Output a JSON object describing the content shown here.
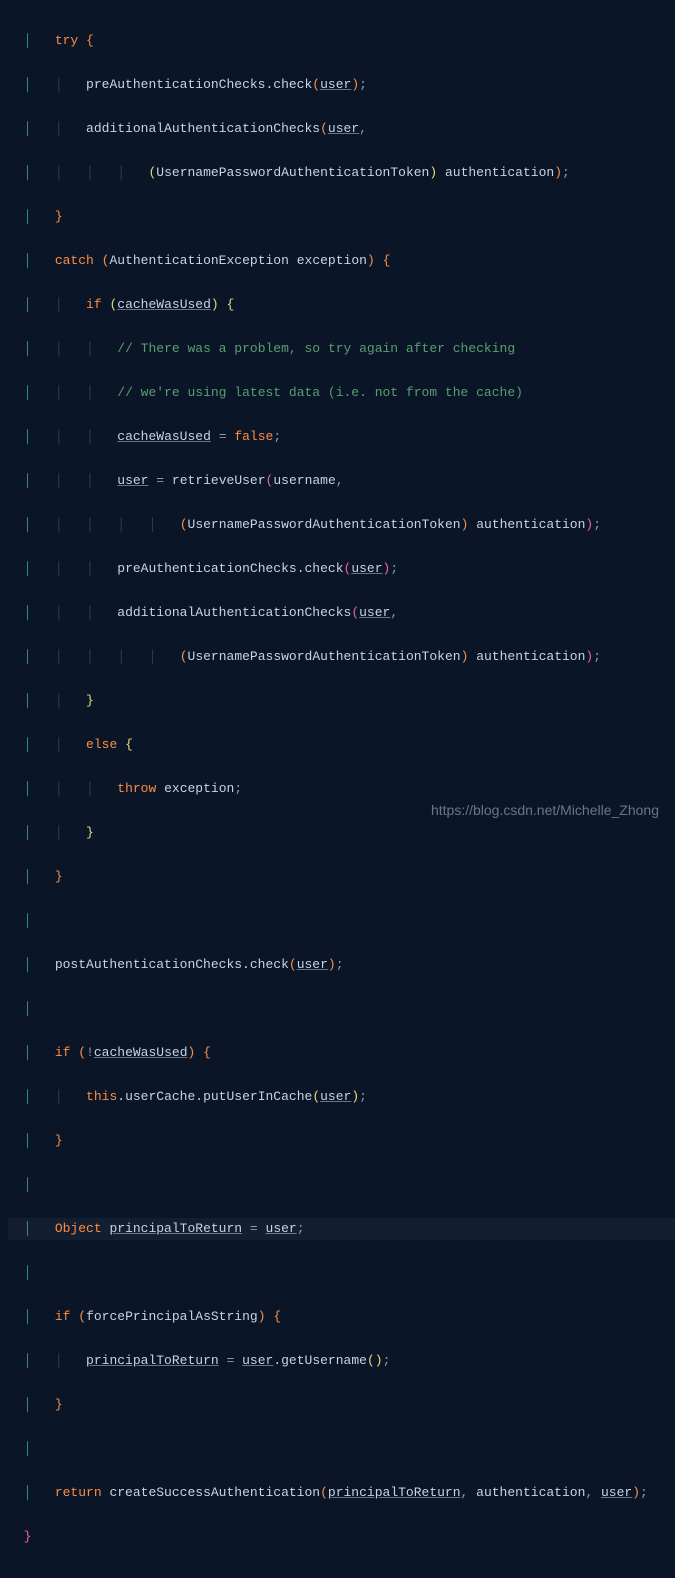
{
  "code": {
    "l1a": "try",
    "l2a": "preAuthenticationChecks.check",
    "l2b": "user",
    "l3a": "additionalAuthenticationChecks",
    "l3b": "user",
    "l4a": "UsernamePasswordAuthenticationToken",
    "l4b": "authentication",
    "l6a": "catch",
    "l6b": "AuthenticationException",
    "l6c": "exception",
    "l7a": "if",
    "l7b": "cacheWasUsed",
    "l8a": "// There was a problem, so try again after checking",
    "l9a": "// we're using latest data (i.e. not from the cache)",
    "l10a": "cacheWasUsed",
    "l10b": "false",
    "l11a": "user",
    "l11b": "retrieveUser",
    "l11c": "username",
    "l12a": "UsernamePasswordAuthenticationToken",
    "l12b": "authentication",
    "l13a": "preAuthenticationChecks.check",
    "l13b": "user",
    "l14a": "additionalAuthenticationChecks",
    "l14b": "user",
    "l15a": "UsernamePasswordAuthenticationToken",
    "l15b": "authentication",
    "l17a": "else",
    "l18a": "throw",
    "l18b": "exception",
    "l22a": "postAuthenticationChecks.check",
    "l22b": "user",
    "l24a": "if",
    "l24b": "cacheWasUsed",
    "l25a": "this",
    "l25b": ".userCache.putUserInCache",
    "l25c": "user",
    "l28a": "Object",
    "l28b": "principalToReturn",
    "l28c": "user",
    "l30a": "if",
    "l30b": "forcePrincipalAsString",
    "l31a": "principalToReturn",
    "l31b": "user",
    "l31c": ".getUsername",
    "l34a": "return",
    "l34b": "createSuccessAuthentication",
    "l34c": "principalToReturn",
    "l34d": "authentication",
    "l34e": "user"
  },
  "watermark": "https://blog.csdn.net/Michelle_Zhong"
}
